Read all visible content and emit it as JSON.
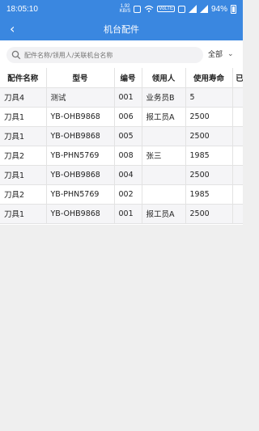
{
  "status": {
    "time": "18:05:10",
    "net_speed_value": "1.92",
    "net_speed_unit": "KB/S",
    "volte": "VoLTE",
    "battery": "94%"
  },
  "nav": {
    "title": "机台配件"
  },
  "search": {
    "placeholder": "配件名称/领用人/关联机台名称",
    "filter_label": "全部"
  },
  "table": {
    "headers": [
      "配件名称",
      "型号",
      "编号",
      "领用人",
      "使用寿命",
      "已"
    ],
    "rows": [
      [
        "刀具4",
        "测试",
        "001",
        "业务员B",
        "5",
        ""
      ],
      [
        "刀具1",
        "YB-OHB9868",
        "006",
        "报工员A",
        "2500",
        ""
      ],
      [
        "刀具1",
        "YB-OHB9868",
        "005",
        "",
        "2500",
        ""
      ],
      [
        "刀具2",
        "YB-PHN5769",
        "008",
        "张三",
        "1985",
        ""
      ],
      [
        "刀具1",
        "YB-OHB9868",
        "004",
        "",
        "2500",
        ""
      ],
      [
        "刀具2",
        "YB-PHN5769",
        "002",
        "",
        "1985",
        ""
      ],
      [
        "刀具1",
        "YB-OHB9868",
        "001",
        "报工员A",
        "2500",
        ""
      ]
    ]
  }
}
